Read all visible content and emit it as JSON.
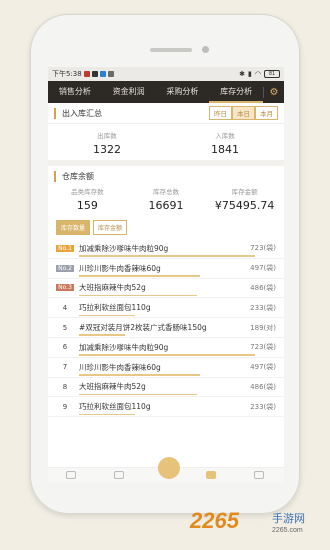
{
  "status": {
    "time": "下午5:38",
    "battery": "81"
  },
  "nav": {
    "tabs": [
      "销售分析",
      "资金利润",
      "采购分析",
      "库存分析"
    ],
    "active": 3
  },
  "summary": {
    "title": "出入库汇总",
    "range": [
      "昨日",
      "本日",
      "本月"
    ],
    "range_active": 1,
    "out_label": "出库数",
    "out_value": "1322",
    "in_label": "入库数",
    "in_value": "1841"
  },
  "balance": {
    "title": "仓库余额",
    "cat_label": "品类库存数",
    "cat_value": "159",
    "total_label": "库存总数",
    "total_value": "16691",
    "amount_label": "库存金额",
    "amount_value": "¥75495.74"
  },
  "toggle": {
    "qty": "库存数量",
    "amount": "库存金额"
  },
  "ranking": [
    {
      "rank": "No.1",
      "name": "加减乘除沙嗲味牛肉粒90g",
      "qty": "723(袋)",
      "ratio": 1.0,
      "color": "#e8a53a"
    },
    {
      "rank": "No.2",
      "name": "川珍川影牛肉香辣味60g",
      "qty": "497(袋)",
      "ratio": 0.69,
      "color": "#9aa0ad"
    },
    {
      "rank": "No.3",
      "name": "大班指麻辣牛肉52g",
      "qty": "486(袋)",
      "ratio": 0.67,
      "color": "#c9785a"
    },
    {
      "rank": "4",
      "name": "巧拉利软丝面包110g",
      "qty": "233(袋)",
      "ratio": 0.32,
      "color": ""
    },
    {
      "rank": "5",
      "name": "#双冠对装月饼2枚装广式香肠味150g",
      "qty": "189(对)",
      "ratio": 0.26,
      "color": ""
    },
    {
      "rank": "6",
      "name": "加减乘除沙嗲味牛肉粒90g",
      "qty": "723(袋)",
      "ratio": 1.0,
      "color": ""
    },
    {
      "rank": "7",
      "name": "川珍川影牛肉香辣味60g",
      "qty": "497(袋)",
      "ratio": 0.69,
      "color": ""
    },
    {
      "rank": "8",
      "name": "大班指麻辣牛肉52g",
      "qty": "486(袋)",
      "ratio": 0.67,
      "color": ""
    },
    {
      "rank": "9",
      "name": "巧拉利软丝面包110g",
      "qty": "233(袋)",
      "ratio": 0.32,
      "color": ""
    }
  ],
  "watermark": {
    "num": "2265",
    "text": "手游网",
    "url": "2265.com"
  }
}
